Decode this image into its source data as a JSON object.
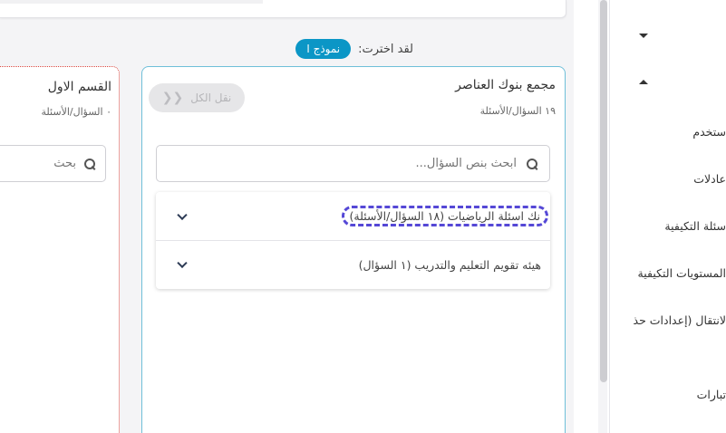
{
  "selection": {
    "label": "لقد اخترت:",
    "badge": "نموذج ا"
  },
  "bank": {
    "title": "مجمع بنوك العناصر",
    "count": "١٩ السؤال/الأسئلة",
    "move_all_label": "نقل الكل",
    "move_all_icon": "double-chevron-left-icon",
    "search_placeholder": "ابحث بنص السؤال...",
    "items": [
      {
        "label": "نك اسئلة الرياضيات (١٨ السؤال/الأسئلة)"
      },
      {
        "label": "هيئه تقويم التعليم والتدريب (١ السؤال)"
      }
    ]
  },
  "section": {
    "title": "القسم الاول",
    "count": "٠ السؤال/الأسئلة",
    "search_placeholder": "بحث"
  },
  "sidebar": {
    "items": [
      {
        "label": "ستخدم"
      },
      {
        "label": "عادلات"
      },
      {
        "label": "سئلة التكيفية"
      },
      {
        "label": "المستويات التكيفية"
      },
      {
        "label": "لانتقال (إعدادات حذ"
      },
      {
        "label": "تبارات"
      }
    ]
  },
  "colors": {
    "accent": "#0b96c6",
    "panel_border": "#6fbfd9",
    "section_border": "#d9463e",
    "highlight": "#5548d6"
  }
}
